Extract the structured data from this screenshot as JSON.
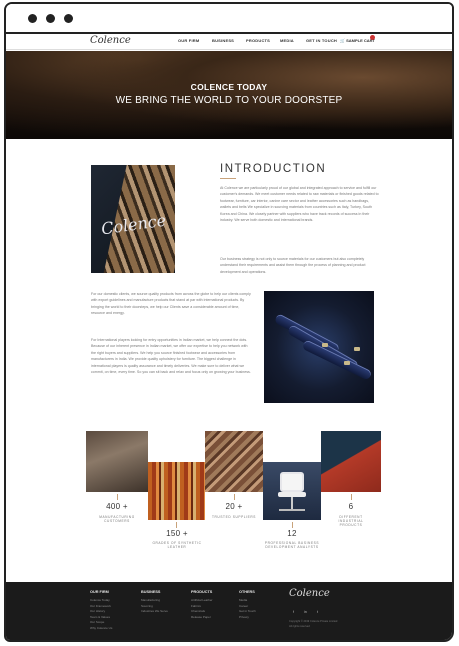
{
  "nav": {
    "logo": "Colence",
    "items": [
      "OUR FIRM",
      "BUSINESS",
      "PRODUCTS",
      "MEDIA",
      "GET IN TOUCH"
    ],
    "cart": "SAMPLE CART"
  },
  "hero": {
    "title": "COLENCE TODAY",
    "subtitle": "WE BRING THE WORLD TO YOUR DOORSTEP"
  },
  "intro": {
    "image_text": "Colence",
    "title": "INTRODUCTION",
    "p1": "At Colence we are particularly proud of our global and integrated approach to service and fulfill our customer's demands. We meet customer needs related to raw materials or finished goods related to footwear, furniture, car interior, canine care sector and leather accessories such as handbags, wallets and belts We specialize in sourcing materials from countries such as Italy, Turkey, South Korea and China. We closely partner with suppliers who have track records of success in their industry. We serve both domestic and international brands.",
    "p2": "Our business strategy is not only to source materials for our customers but also completely understand their requirements and assist them through the process of planning and product development and operations.",
    "p3": "For our domestic clients, we source quality products from across the globe to help our clients comply with export guidelines and manufacture products that stand at par with international products. By bringing the world to their doorsteps, we help our Clients save a considerable amount of time, resource and energy.",
    "p4": "For International players looking for entry opportunities in Indian market, we help connect the dots. Because of our inherent presence in Indian market, we offer our expertise to help you network with the right buyers and suppliers. We help you source finished footwear and accessories from manufacturers in India. We provide quality upholstery for furniture. The biggest challenge in international players is quality assurance and timely deliveries. We make sure to deliver what we commit, on time, every time. So you can sit back and relax and focus only on growing your business."
  },
  "stats": [
    {
      "num": "400 +",
      "label": "MANUFACTURING CUSTOMERS"
    },
    {
      "num": "150 +",
      "label": "GRADES OF SYNTHETIC LEATHER"
    },
    {
      "num": "20 +",
      "label": "TRUSTED SUPPLIERS"
    },
    {
      "num": "12",
      "label": "PROFESSIONAL BUSINESS DEVELOPMENT ANALYSTS"
    },
    {
      "num": "6",
      "label": "DIFFERENT INDUSTRIAL PRODUCTS"
    }
  ],
  "footer": {
    "cols": [
      {
        "head": "OUR FIRM",
        "items": [
          "Colence Today",
          "Our Framework",
          "Our History",
          "Team & Values",
          "Our Scope",
          "Why Colence Us"
        ]
      },
      {
        "head": "BUSINESS",
        "items": [
          "Manufacturing",
          "Sourcing",
          "Industries We Serve"
        ]
      },
      {
        "head": "PRODUCTS",
        "items": [
          "Artificial Leather",
          "Fabrics",
          "Chemicals",
          "Release Paper"
        ]
      },
      {
        "head": "OTHERS",
        "items": [
          "Media",
          "Career",
          "Get in Touch",
          "Privacy"
        ]
      }
    ],
    "logo": "Colence",
    "social": [
      "f",
      "in",
      "t"
    ],
    "copyright": "Copyright © 2019 Colence Private Limited",
    "rights": "All rights reserved"
  }
}
